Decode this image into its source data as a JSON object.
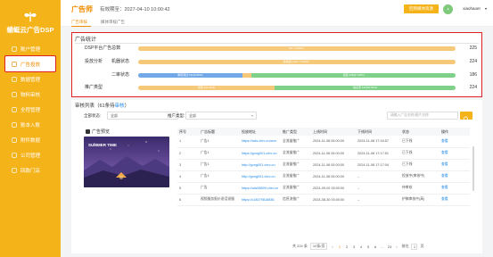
{
  "brand": {
    "name": "蜻蜓云广告DSP"
  },
  "sidebar": {
    "items": [
      {
        "label": "账户管理",
        "icon": "user-icon"
      },
      {
        "label": "广告投放",
        "icon": "megaphone-icon",
        "active": true
      },
      {
        "label": "数据管理",
        "icon": "data-icon"
      },
      {
        "label": "物料审核",
        "icon": "audit-icon"
      },
      {
        "label": "全程管理",
        "icon": "manage-icon"
      },
      {
        "label": "账本入账",
        "icon": "ledger-icon"
      },
      {
        "label": "附件数据",
        "icon": "attachment-icon"
      },
      {
        "label": "公司管理",
        "icon": "company-icon"
      },
      {
        "label": "回款门店",
        "icon": "store-icon"
      }
    ]
  },
  "header": {
    "title": "广告师",
    "valid_label": "有效期至：2027-04-10 10:00:42",
    "action_button": "回到媒体资源",
    "user": "xiaohaoer",
    "tabs": [
      "广告审核",
      "媒体审核广告"
    ]
  },
  "stats": {
    "title": "广告统计",
    "rows": [
      {
        "label": "DSP平台广告总数",
        "sub": "",
        "total": "225",
        "segments": [
          {
            "text": "225（100%）",
            "fraction": 1.0,
            "color": "#f6c97a"
          }
        ]
      },
      {
        "label": "投放分析",
        "sub": "机器状态",
        "total": "224",
        "segments": [
          {
            "text": "投放接入224（100%）",
            "fraction": 1.0,
            "color": "#f6c97a"
          }
        ]
      },
      {
        "label": "",
        "sub": "二审状态",
        "total": "186",
        "segments": [
          {
            "text": "审核通过 61(32.80%)",
            "fraction": 0.328,
            "color": "#72a8e8"
          },
          {
            "text": "",
            "fraction": 0.03,
            "color": "#f6c97a"
          },
          {
            "text": "拒绝 125(67.20%)",
            "fraction": 0.642,
            "color": "#7fd18a"
          }
        ]
      },
      {
        "label": "推广类型",
        "sub": "",
        "total": "224",
        "segments": [
          {
            "text": "搜索 1(0.45%)",
            "fraction": 0.43,
            "color": "#f6c97a"
          },
          {
            "text": "信息流 123(54.91%)",
            "fraction": 0.57,
            "color": "#7fd18a"
          }
        ]
      }
    ]
  },
  "audit": {
    "title_prefix": "审核列表（61条待",
    "title_highlight": "审核",
    "title_suffix": "）",
    "filters": {
      "status_label": "全部状态:",
      "status_value": "全部",
      "type_label": "推广类型:",
      "type_value": "全部",
      "search_placeholder": "请输入广告名称/图片名称"
    },
    "preview_label": "广告预览",
    "preview_image_text": "SUMMER TIME",
    "columns": [
      "序号",
      "广告标题",
      "投放地址",
      "推广类型",
      "上线时间",
      "下线时间",
      "状态",
      "操作"
    ],
    "rows": [
      [
        "1",
        "广告1",
        "https://wds.chrc.cn/ann",
        "全流量推广",
        "2024-11-08 00:00:00",
        "2024-11-08 17:16:57",
        "已下线",
        "查看"
      ],
      [
        "2",
        "广告1",
        "https://gong001.chrc.cn",
        "全流量推广",
        "2024-11-08 00:00:00",
        "2024-11-08 17:17:51",
        "已下线",
        "查看"
      ],
      [
        "3",
        "广告1",
        "http://gong001.chrc.cn",
        "全流量推广",
        "2024-11-08 00:00:00",
        "2024-11-08 17:17:04",
        "已下线",
        "查看"
      ],
      [
        "4",
        "广告1",
        "http://gong001.chrc.cn",
        "全流量推广",
        "2024-11-08 00:00:00",
        "--",
        "投放中(审核中)",
        "查看"
      ],
      [
        "5",
        "广告",
        "https://xds08809.chrc.cn",
        "全流量推广",
        "2024-09-02 00:00:00",
        "--",
        "待审核",
        "查看"
      ],
      [
        "6",
        "视频服务报价说话说服",
        "https://c18079818836",
        "信息流推广",
        "2024-08-30 00:00:00",
        "--",
        "护稿审核中(高)",
        "查看"
      ]
    ],
    "pager": {
      "total": "共 224 条",
      "page_size": "10条/页",
      "pages": [
        "1",
        "2",
        "3",
        "4",
        "5",
        "6",
        "...",
        "23"
      ],
      "prev": "‹",
      "next": "›",
      "goto_label": "前往",
      "goto_value": "1",
      "goto_suffix": "页"
    }
  }
}
